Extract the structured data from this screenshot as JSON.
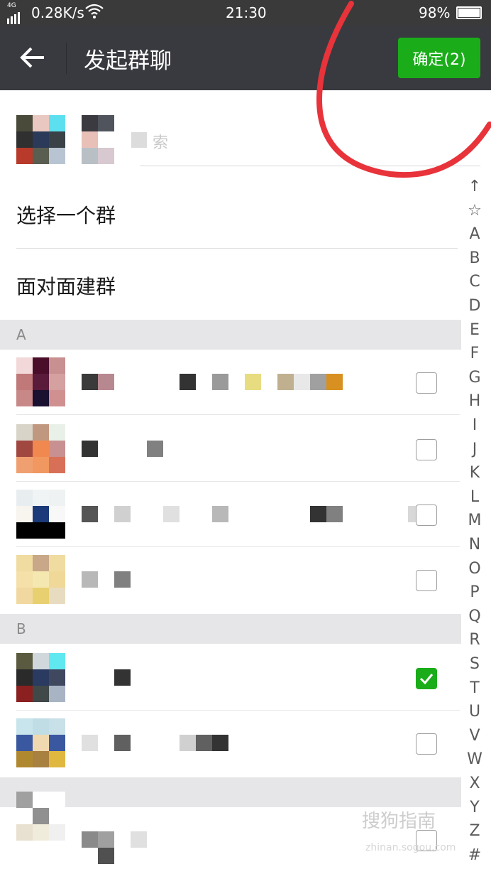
{
  "status_bar": {
    "network_tag": "4G",
    "speed": "0.28K/s",
    "time": "21:30",
    "battery": "98%"
  },
  "header": {
    "title": "发起群聊",
    "confirm_label": "确定(2)",
    "confirm_color": "#1aad19",
    "background_color": "#393a3f"
  },
  "selected": {
    "search_placeholder": "索"
  },
  "menu": {
    "select_group": "选择一个群",
    "face_to_face": "面对面建群"
  },
  "sections": {
    "a_letter": "A",
    "b_letter": "B"
  },
  "contacts": [
    {
      "section": "A",
      "checked": false
    },
    {
      "section": "A",
      "checked": false
    },
    {
      "section": "A",
      "checked": false
    },
    {
      "section": "A",
      "checked": false
    },
    {
      "section": "B",
      "checked": true
    },
    {
      "section": "B",
      "checked": false
    },
    {
      "section": "",
      "checked": false
    }
  ],
  "alphabet_index": [
    "↑",
    "☆",
    "A",
    "B",
    "C",
    "D",
    "E",
    "F",
    "G",
    "H",
    "I",
    "J",
    "K",
    "L",
    "M",
    "N",
    "O",
    "P",
    "Q",
    "R",
    "S",
    "T",
    "U",
    "V",
    "W",
    "X",
    "Y",
    "Z",
    "#"
  ],
  "watermark": {
    "text": "搜狗指南",
    "url": "zhinan.sogou.com"
  },
  "annotation_color": "#e8333b"
}
